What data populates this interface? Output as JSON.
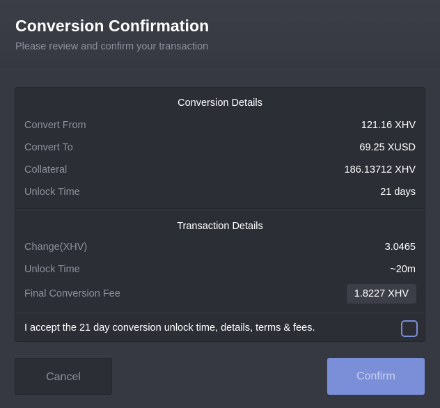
{
  "header": {
    "title": "Conversion Confirmation",
    "subtitle": "Please review and confirm your transaction"
  },
  "conversion_details": {
    "title": "Conversion Details",
    "rows": [
      {
        "label": "Convert From",
        "value": "121.16 XHV"
      },
      {
        "label": "Convert To",
        "value": "69.25 XUSD"
      },
      {
        "label": "Collateral",
        "value": "186.13712 XHV"
      },
      {
        "label": "Unlock Time",
        "value": "21 days"
      }
    ]
  },
  "transaction_details": {
    "title": "Transaction Details",
    "rows": [
      {
        "label": "Change(XHV)",
        "value": "3.0465"
      },
      {
        "label": "Unlock Time",
        "value": "~20m"
      },
      {
        "label": "Final Conversion Fee",
        "value": "1.8227 XHV"
      }
    ],
    "accept_label": "I accept the 21 day conversion unlock time, details, terms & fees.",
    "accept_checked": false
  },
  "buttons": {
    "cancel": "Cancel",
    "confirm": "Confirm"
  },
  "colors": {
    "background": "#363842",
    "panel": "#2c2e36",
    "accent": "#7b8ed8",
    "muted_text": "#8d909b"
  }
}
